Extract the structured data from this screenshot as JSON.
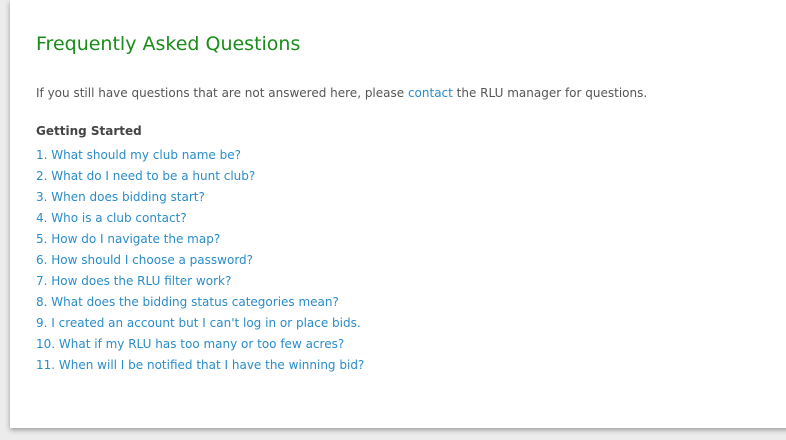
{
  "colors": {
    "title": "#1a8c1a",
    "link": "#2a8cc8",
    "body_text": "#555555",
    "background": "#ececec",
    "panel": "#ffffff"
  },
  "page": {
    "title": "Frequently Asked Questions"
  },
  "intro": {
    "before": "If you still have questions that are not answered here, please ",
    "link": "contact",
    "after": " the RLU manager for questions."
  },
  "section": {
    "heading": "Getting Started",
    "questions": [
      "1. What should my club name be?",
      "2. What do I need to be a hunt club?",
      "3. When does bidding start?",
      "4. Who is a club contact?",
      "5. How do I navigate the map?",
      "6. How should I choose a password?",
      "7. How does the RLU filter work?",
      "8. What does the bidding status categories mean?",
      "9. I created an account but I can't log in or place bids.",
      "10. What if my RLU has too many or too few acres?",
      "11. When will I be notified that I have the winning bid?"
    ]
  }
}
